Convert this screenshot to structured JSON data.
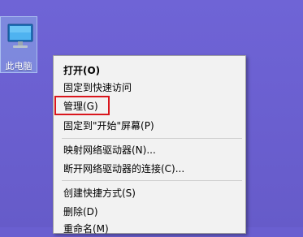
{
  "desktop": {
    "background_color": "#6a5fd0",
    "icon": {
      "label": "此电脑",
      "icon_name": "computer-icon"
    }
  },
  "context_menu": {
    "items": [
      {
        "label": "打开(O)",
        "bold": true
      },
      {
        "label": "固定到快速访问"
      },
      {
        "label": "管理(G)",
        "highlighted": true
      },
      {
        "label": "固定到\"开始\"屏幕(P)"
      },
      {
        "label": "映射网络驱动器(N)..."
      },
      {
        "label": "断开网络驱动器的连接(C)..."
      },
      {
        "label": "创建快捷方式(S)"
      },
      {
        "label": "删除(D)"
      },
      {
        "label": "重命名(M)"
      }
    ],
    "highlight_color": "#d9161d"
  }
}
